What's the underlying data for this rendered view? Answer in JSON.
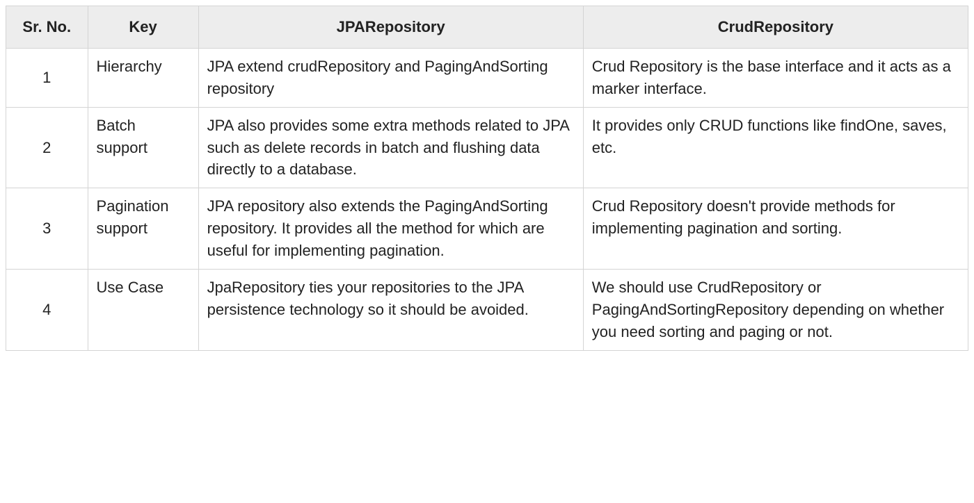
{
  "table": {
    "headers": {
      "sr": "Sr. No.",
      "key": "Key",
      "jpa": "JPARepository",
      "crud": "CrudRepository"
    },
    "rows": [
      {
        "sr": "1",
        "key": "Hierarchy",
        "jpa": "JPA extend crudRepository and PagingAndSorting repository",
        "crud": "Crud Repository is the base interface and it acts as a marker interface."
      },
      {
        "sr": "2",
        "key": "Batch support",
        "jpa": "JPA also provides some extra methods related to JPA such as delete records in batch and flushing data directly to a database.",
        "crud": "It provides only CRUD functions like findOne, saves, etc."
      },
      {
        "sr": "3",
        "key": "Pagination support",
        "jpa": "JPA repository also extends the PagingAndSorting repository. It provides all the method for which are useful for implementing pagination.",
        "crud": "Crud Repository doesn't provide methods for implementing pagination and sorting."
      },
      {
        "sr": "4",
        "key": "Use Case",
        "jpa": "JpaRepository ties your repositories to the JPA persistence technology so it should be avoided.",
        "crud": "We should use CrudRepository or PagingAndSortingRepository depending on whether you need sorting and paging or not."
      }
    ]
  }
}
